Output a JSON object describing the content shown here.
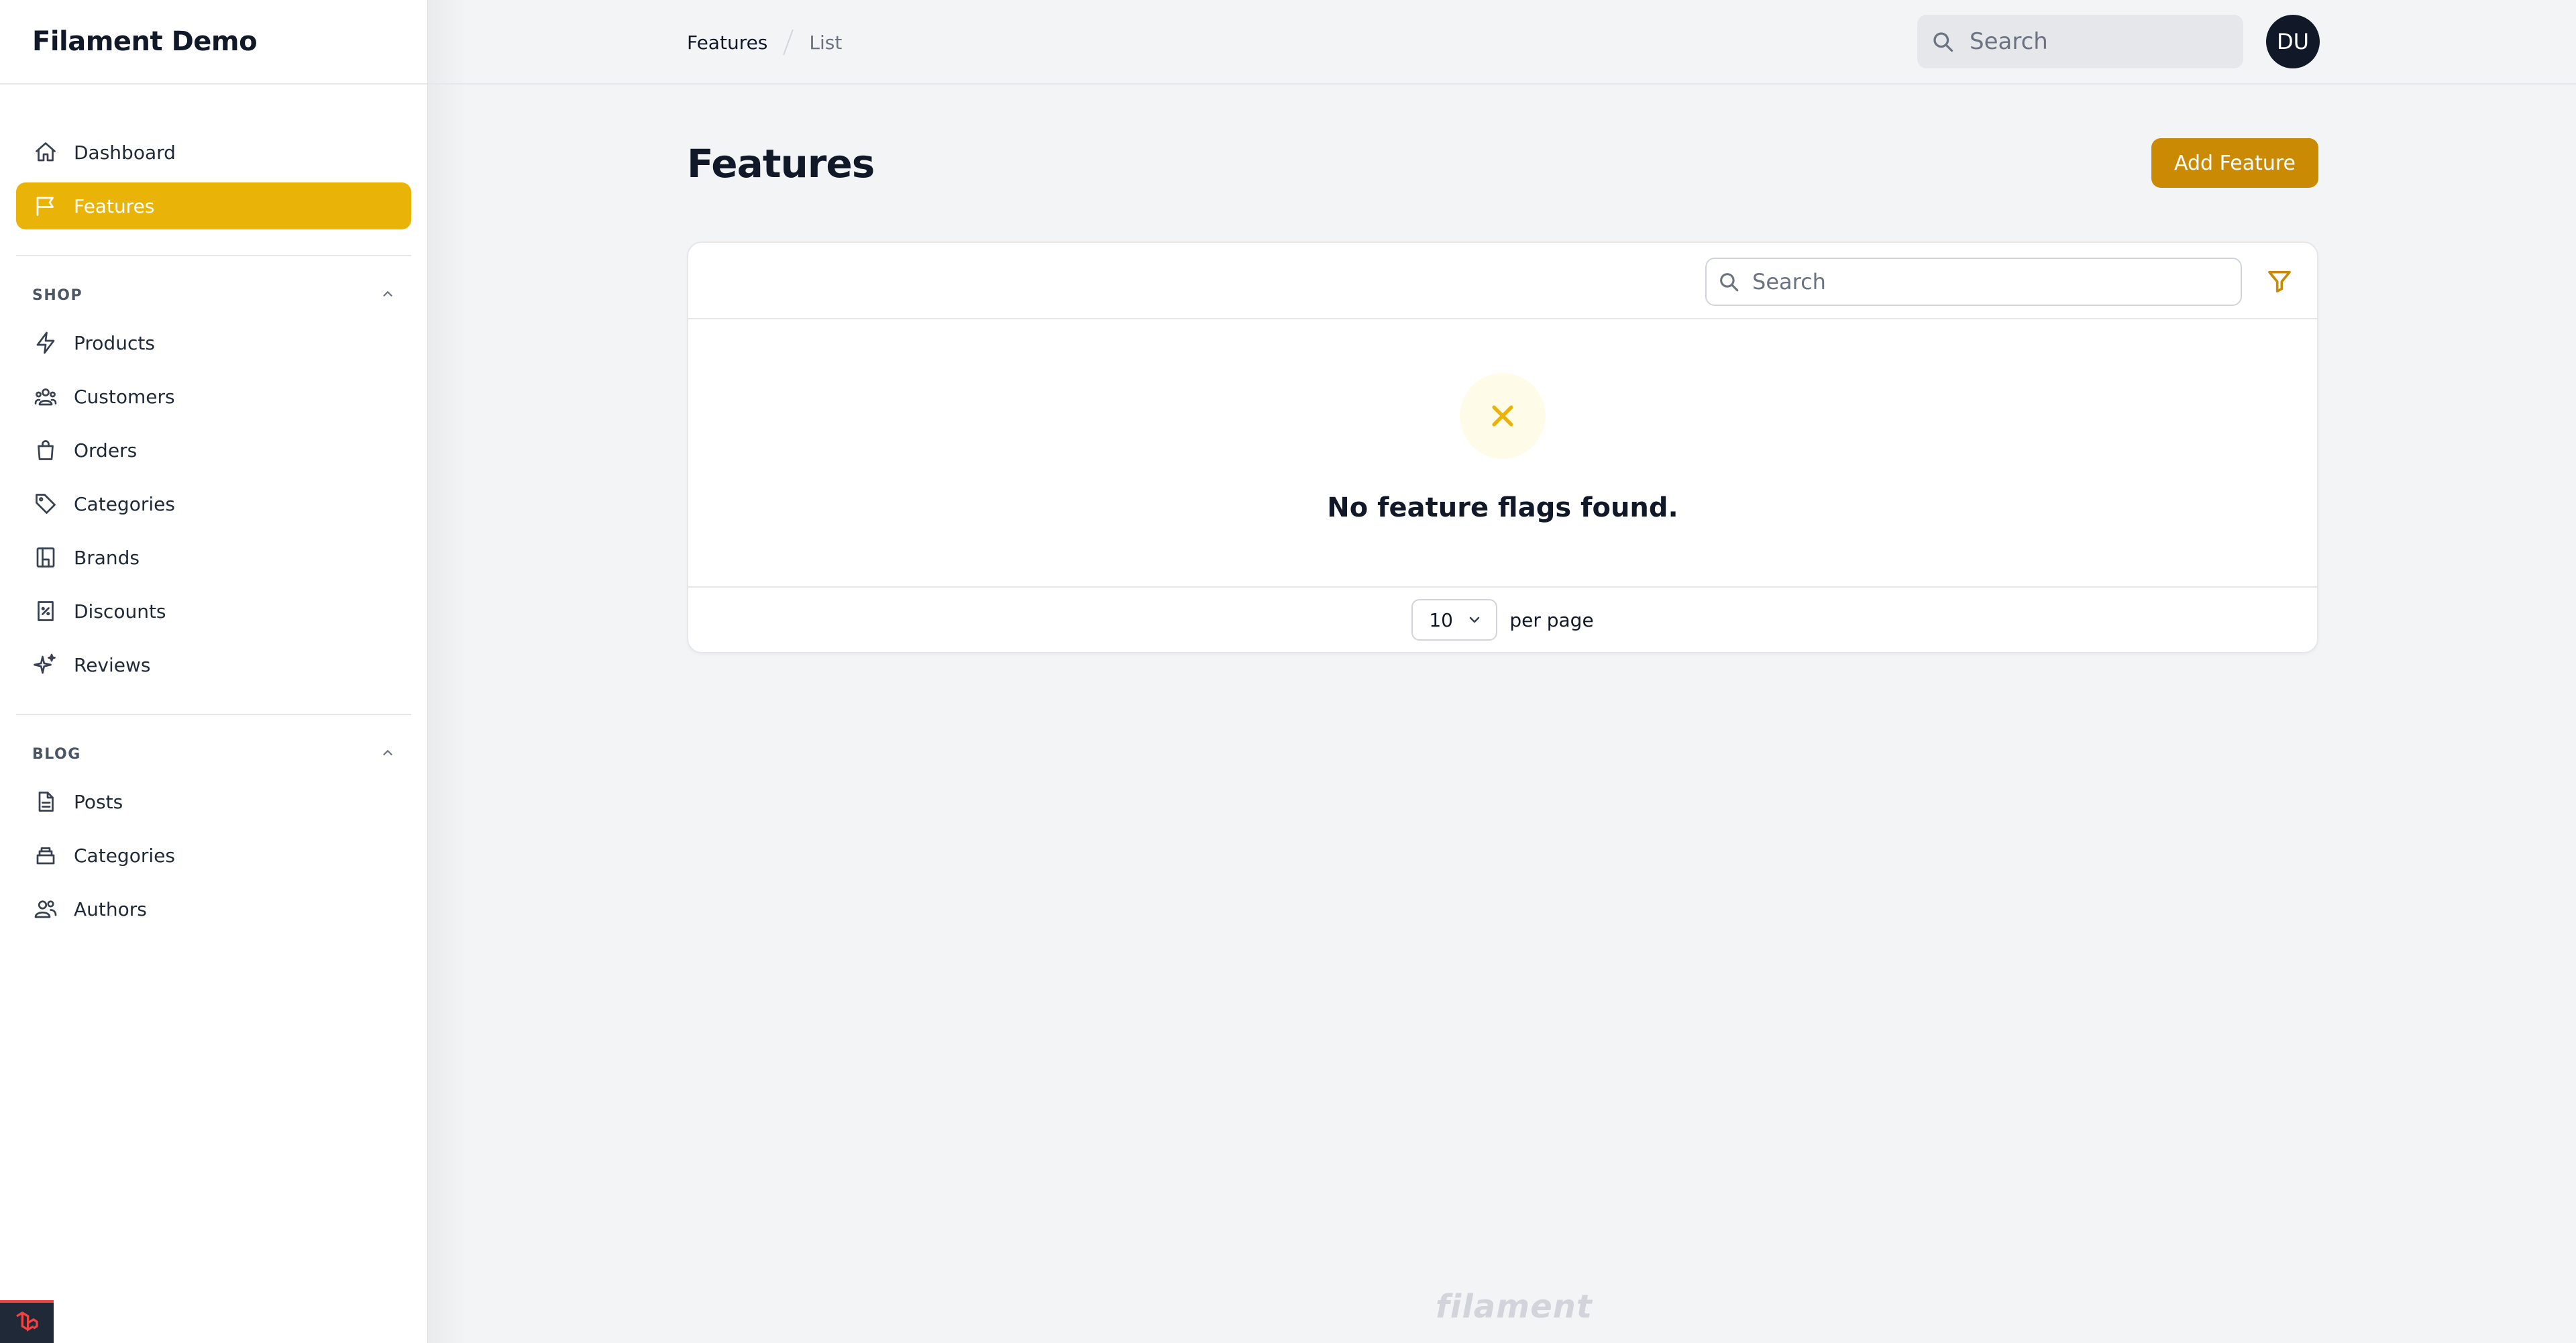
{
  "app": {
    "brand": "Filament Demo"
  },
  "sidebar": {
    "top_items": [
      {
        "label": "Dashboard",
        "icon": "home-icon"
      },
      {
        "label": "Features",
        "icon": "flag-icon",
        "active": true
      }
    ],
    "groups": [
      {
        "title": "SHOP",
        "items": [
          {
            "label": "Products",
            "icon": "bolt-icon"
          },
          {
            "label": "Customers",
            "icon": "users-icon"
          },
          {
            "label": "Orders",
            "icon": "shopping-bag-icon"
          },
          {
            "label": "Categories",
            "icon": "tag-icon"
          },
          {
            "label": "Brands",
            "icon": "building-icon"
          },
          {
            "label": "Discounts",
            "icon": "receipt-percent-icon"
          },
          {
            "label": "Reviews",
            "icon": "sparkles-icon"
          }
        ]
      },
      {
        "title": "BLOG",
        "items": [
          {
            "label": "Posts",
            "icon": "document-icon"
          },
          {
            "label": "Categories",
            "icon": "inbox-stack-icon"
          },
          {
            "label": "Authors",
            "icon": "user-group-icon"
          }
        ]
      }
    ]
  },
  "topbar": {
    "breadcrumb": [
      "Features",
      "List"
    ],
    "search_placeholder": "Search",
    "avatar_initials": "DU"
  },
  "page": {
    "title": "Features",
    "add_button": "Add Feature"
  },
  "table": {
    "search_placeholder": "Search",
    "empty_message": "No feature flags found.",
    "per_page_value": "10",
    "per_page_label": "per page"
  },
  "footer": {
    "logo_text": "filament"
  },
  "colors": {
    "accent": "#eab308",
    "button": "#ca8a04",
    "dark": "#111827"
  }
}
